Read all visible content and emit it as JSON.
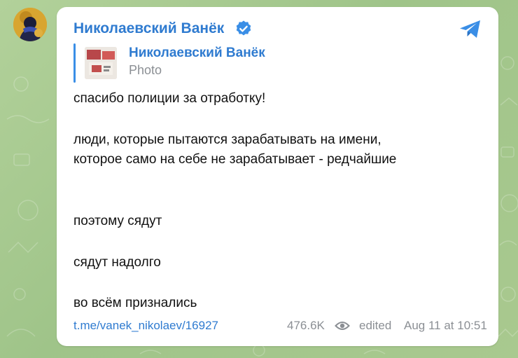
{
  "post": {
    "channel_name": "Николаевский Ванёк",
    "verified_icon": "verified-badge-icon",
    "share_icon": "telegram-share-icon",
    "reply": {
      "author": "Николаевский Ванёк",
      "media_type": "Photo"
    },
    "lines": [
      "спасибо полиции за отработку!",
      "люди, которые пытаются зарабатывать на имени,",
      "которое само на себе не зарабатывает - редчайшие",
      "поэтому сядут",
      "сядут надолго",
      "во всём признались"
    ],
    "footer": {
      "link": "t.me/vanek_nikolaev/16927",
      "views": "476.6K",
      "views_icon": "eye-icon",
      "edited": "edited",
      "date": "Aug 11 at 10:51"
    }
  },
  "colors": {
    "accent": "#2f7bd0",
    "muted": "#8b8f94",
    "background": "#a8c98e"
  }
}
